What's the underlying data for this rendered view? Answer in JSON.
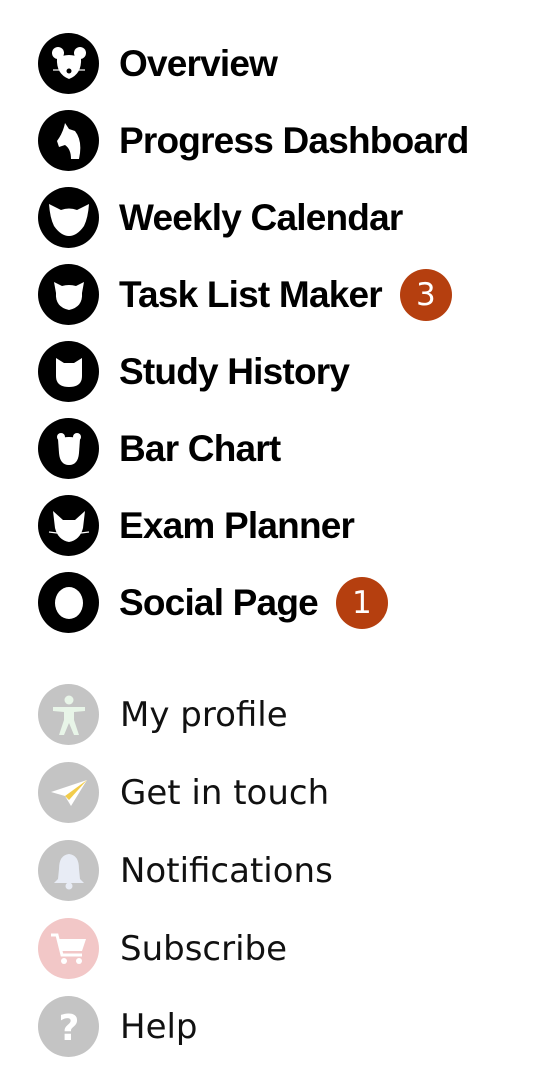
{
  "nav": {
    "items": [
      {
        "label": "Overview",
        "icon": "bear-icon"
      },
      {
        "label": "Progress Dashboard",
        "icon": "horse-icon"
      },
      {
        "label": "Weekly Calendar",
        "icon": "owl-icon"
      },
      {
        "label": "Task List Maker",
        "icon": "pig-icon",
        "badge": "3"
      },
      {
        "label": "Study History",
        "icon": "cat-icon"
      },
      {
        "label": "Bar Chart",
        "icon": "bear-head-icon"
      },
      {
        "label": "Exam Planner",
        "icon": "fox-icon"
      },
      {
        "label": "Social Page",
        "icon": "ring-icon",
        "badge": "1"
      }
    ]
  },
  "secondary": {
    "items": [
      {
        "label": "My profile",
        "icon": "accessibility-person-icon"
      },
      {
        "label": "Get in touch",
        "icon": "paper-plane-icon"
      },
      {
        "label": "Notifications",
        "icon": "bell-icon"
      },
      {
        "label": "Subscribe",
        "icon": "shopping-cart-icon"
      },
      {
        "label": "Help",
        "icon": "question-mark-icon"
      }
    ]
  },
  "colors": {
    "badge": "#b53f0f",
    "icon_dark": "#000000",
    "icon_gray": "#c4c4c4",
    "icon_pink": "#f2c7c7"
  }
}
